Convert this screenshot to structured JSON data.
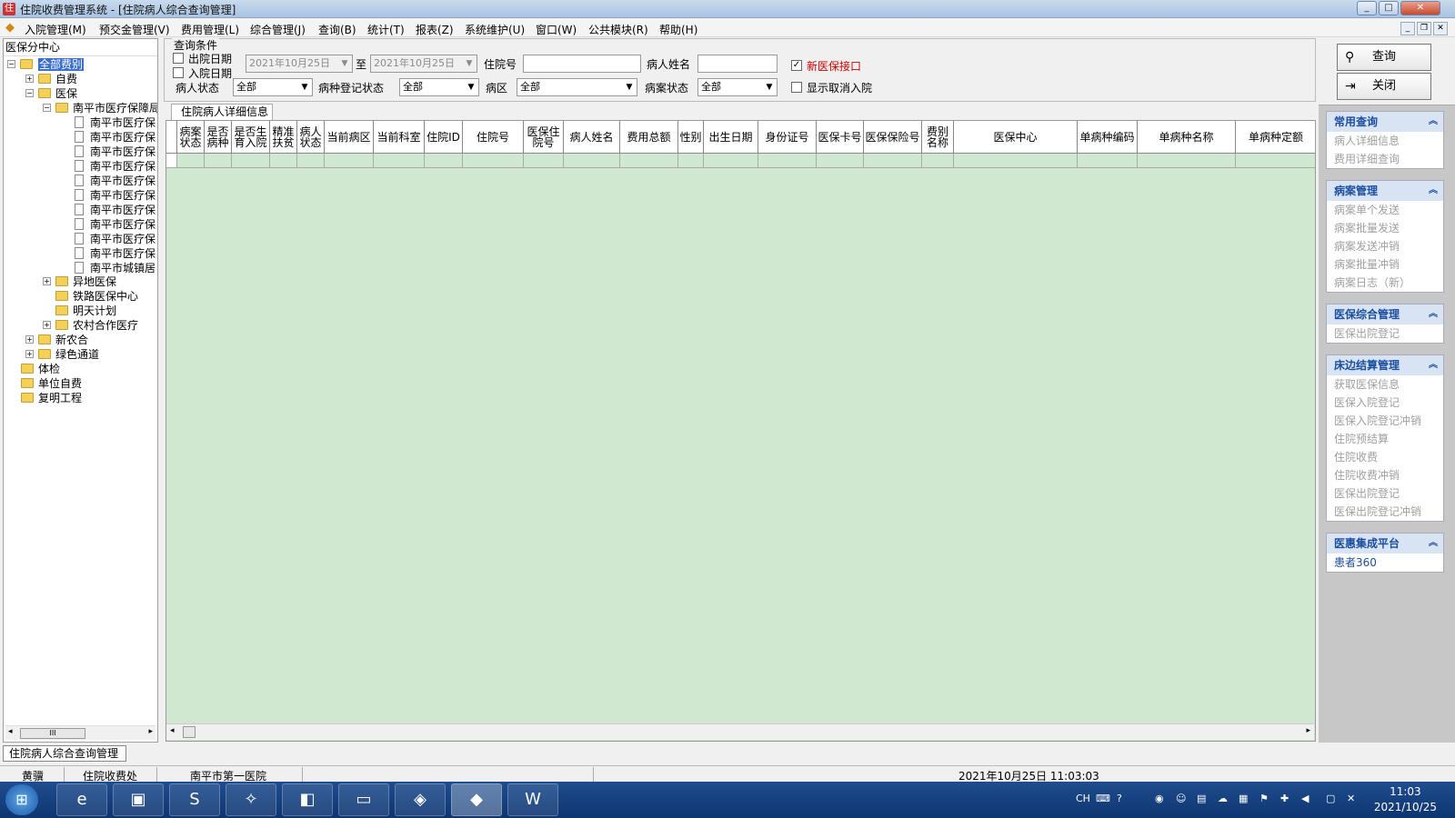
{
  "window": {
    "title": "住院收费管理系统 - [住院病人综合查询管理]",
    "min": "_",
    "max": "□",
    "close": "✕"
  },
  "menu": [
    "入院管理(M)",
    "预交金管理(V)",
    "费用管理(L)",
    "综合管理(J)",
    "查询(B)",
    "统计(T)",
    "报表(Z)",
    "系统维护(U)",
    "窗口(W)",
    "公共模块(R)",
    "帮助(H)"
  ],
  "mdi": {
    "min": "_",
    "restore": "❐",
    "close": "✕"
  },
  "tree": {
    "header": "医保分中心",
    "nodes": [
      {
        "label": "全部费别",
        "selected": true
      },
      {
        "label": "自费"
      },
      {
        "label": "医保"
      },
      {
        "label": "南平市医疗保障局"
      },
      {
        "label": "南平市医疗保"
      },
      {
        "label": "南平市医疗保"
      },
      {
        "label": "南平市医疗保"
      },
      {
        "label": "南平市医疗保"
      },
      {
        "label": "南平市医疗保"
      },
      {
        "label": "南平市医疗保"
      },
      {
        "label": "南平市医疗保"
      },
      {
        "label": "南平市医疗保"
      },
      {
        "label": "南平市医疗保"
      },
      {
        "label": "南平市医疗保"
      },
      {
        "label": "南平市城镇居"
      },
      {
        "label": "异地医保"
      },
      {
        "label": "铁路医保中心"
      },
      {
        "label": "明天计划"
      },
      {
        "label": "农村合作医疗"
      },
      {
        "label": "新农合"
      },
      {
        "label": "绿色通道"
      },
      {
        "label": "体检"
      },
      {
        "label": "单位自费"
      },
      {
        "label": "复明工程"
      }
    ],
    "scroll_thumb": "III"
  },
  "query": {
    "legend": "查询条件",
    "discharge_date": "出院日期",
    "admit_date": "入院日期",
    "date_from": "2021年10月25日",
    "to": "至",
    "date_to": "2021年10月25日",
    "inpatient_no": "住院号",
    "patient_name": "病人姓名",
    "new_interface": "新医保接口",
    "patient_status": "病人状态",
    "patient_status_val": "全部",
    "disease_reg_status": "病种登记状态",
    "disease_reg_val": "全部",
    "ward": "病区",
    "ward_val": "全部",
    "case_status": "病案状态",
    "case_status_val": "全部",
    "show_cancelled": "显示取消入院"
  },
  "grid": {
    "tab": "住院病人详细信息",
    "columns": [
      "病案状态",
      "是否病种",
      "是否生育入院",
      "精准扶贫",
      "病人状态",
      "当前病区",
      "当前科室",
      "住院ID",
      "住院号",
      "医保住院号",
      "病人姓名",
      "费用总额",
      "性别",
      "出生日期",
      "身份证号",
      "医保卡号",
      "医保保险号",
      "费别名称",
      "医保中心",
      "单病种编码",
      "单病种名称",
      "单病种定额"
    ]
  },
  "right": {
    "query_btn": "查询",
    "close_btn": "关闭",
    "groups": [
      {
        "title": "常用查询",
        "items": [
          "病人详细信息",
          "费用详细查询"
        ]
      },
      {
        "title": "病案管理",
        "items": [
          "病案单个发送",
          "病案批量发送",
          "病案发送冲销",
          "病案批量冲销",
          "病案日志（新）"
        ]
      },
      {
        "title": "医保综合管理",
        "items": [
          "医保出院登记"
        ]
      },
      {
        "title": "床边结算管理",
        "items": [
          "获取医保信息",
          "医保入院登记",
          "医保入院登记冲销",
          "住院预结算",
          "住院收费",
          "住院收费冲销",
          "医保出院登记",
          "医保出院登记冲销"
        ]
      },
      {
        "title": "医惠集成平台",
        "items": [
          "患者360"
        ]
      }
    ]
  },
  "bottom_tab": "住院病人综合查询管理",
  "status": {
    "user": "黄骥",
    "dept": "住院收费处",
    "hospital": "南平市第一医院",
    "datetime": "2021年10月25日 11:03:03"
  },
  "taskbar": {
    "lang": "CH",
    "time": "11:03",
    "date": "2021/10/25"
  },
  "colors": {
    "grid_bg": "#cfe8cf",
    "group_header": "#d8e4f3",
    "accent": "#1b4ea0",
    "red_label": "#d00000"
  }
}
